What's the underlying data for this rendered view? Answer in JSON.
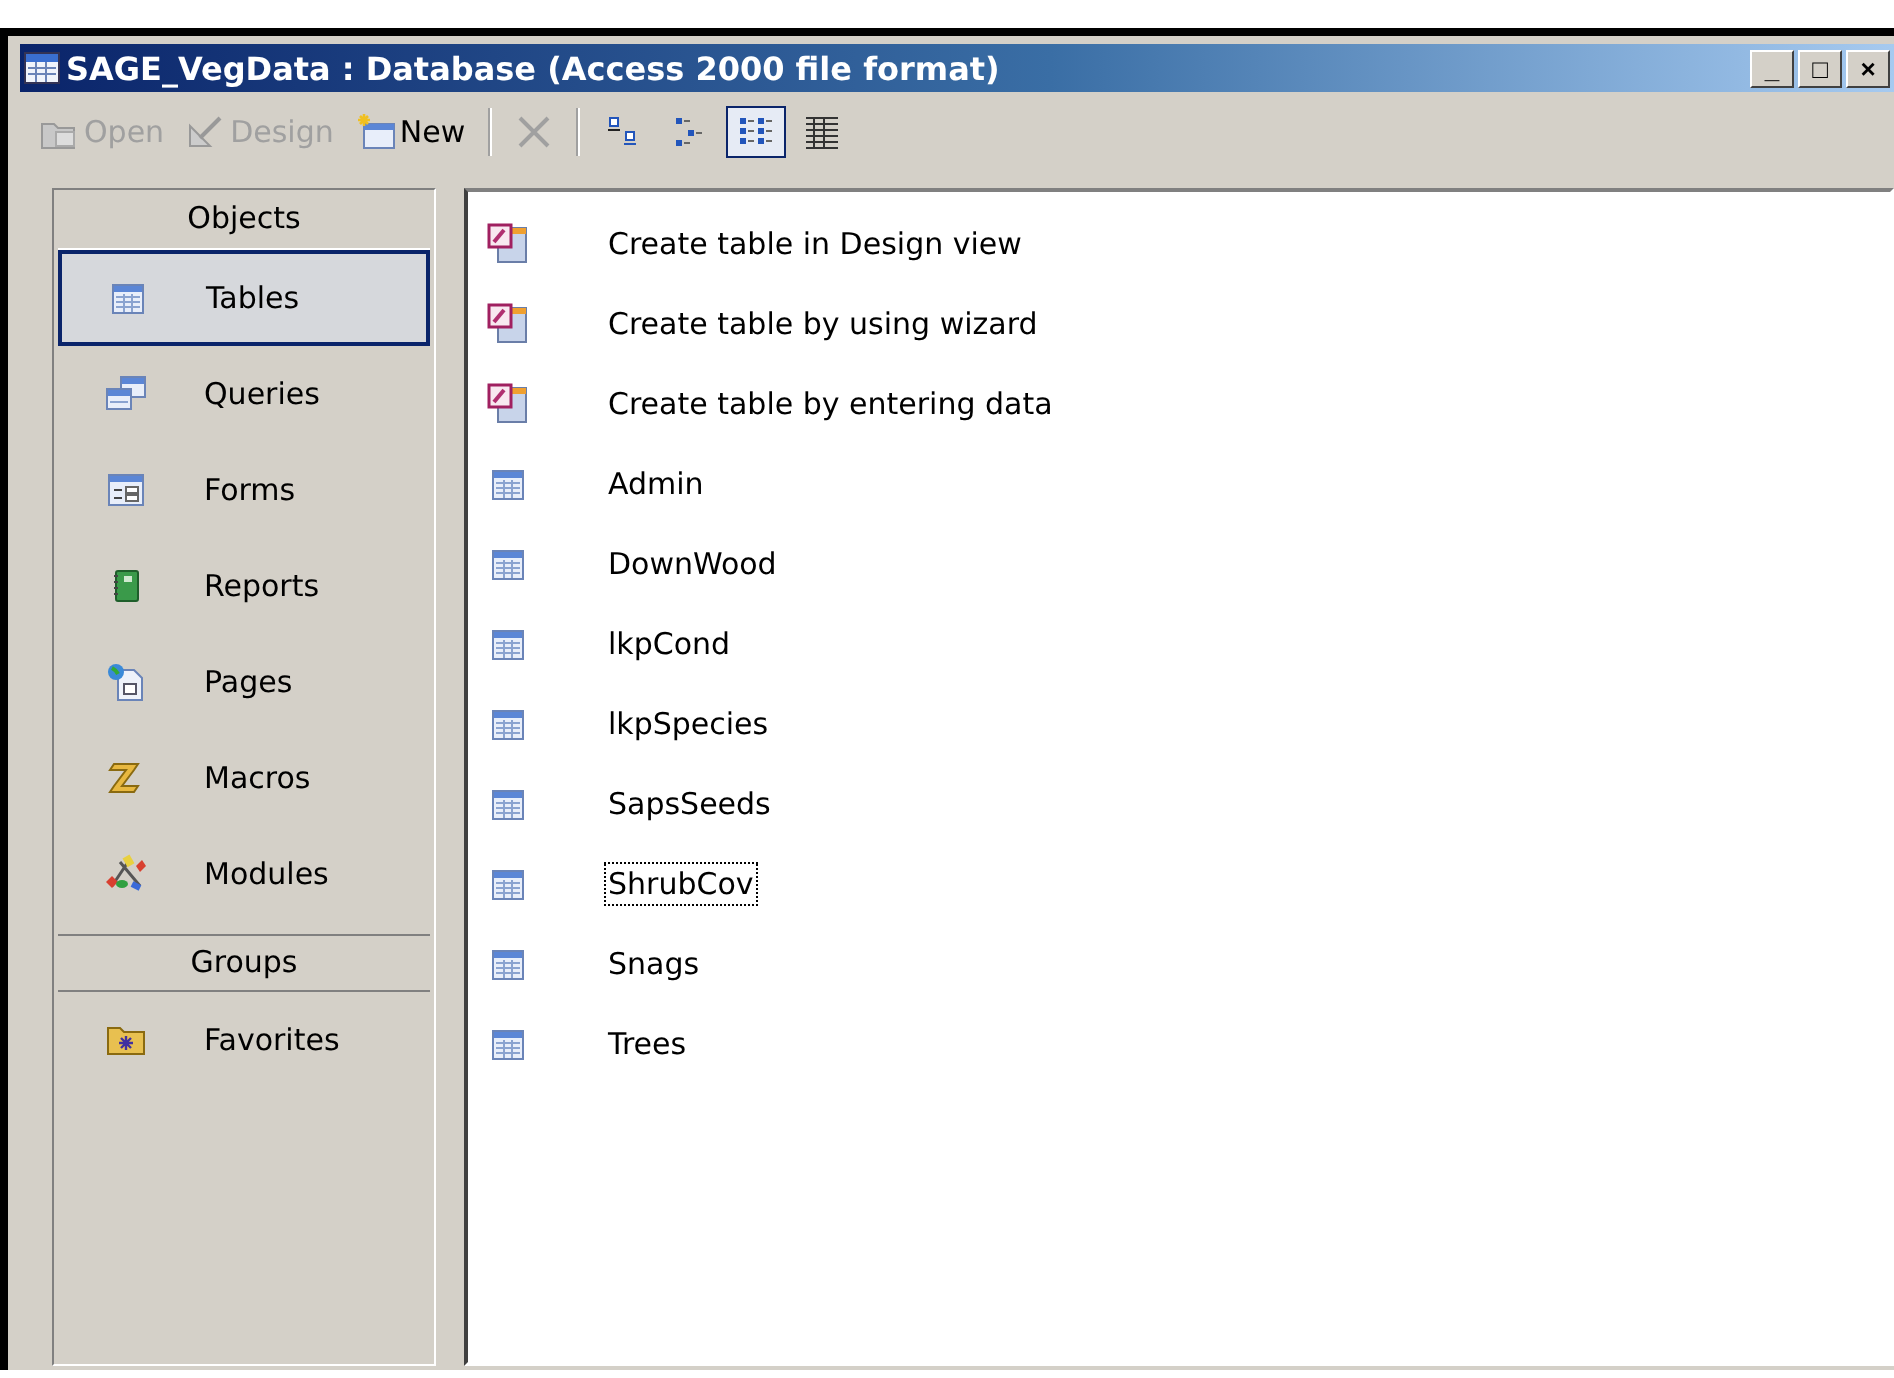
{
  "window": {
    "title": "SAGE_VegData : Database (Access 2000 file format)",
    "controls": [
      "_",
      "□",
      "×"
    ]
  },
  "toolbar": [
    {
      "kind": "open",
      "label": "Open",
      "disabled": true
    },
    {
      "kind": "design",
      "label": "Design",
      "disabled": true
    },
    {
      "kind": "new",
      "label": "New",
      "disabled": false
    },
    {
      "kind": "delete",
      "disabled": true
    },
    {
      "kind": "large-icons",
      "selected": false
    },
    {
      "kind": "small-icons",
      "selected": false
    },
    {
      "kind": "list",
      "selected": true
    },
    {
      "kind": "details",
      "selected": false
    }
  ],
  "sidebar": {
    "objects_heading": "Objects",
    "items": [
      {
        "kind": "tables",
        "label": "Tables",
        "selected": true
      },
      {
        "kind": "queries",
        "label": "Queries",
        "selected": false
      },
      {
        "kind": "forms",
        "label": "Forms",
        "selected": false
      },
      {
        "kind": "reports",
        "label": "Reports",
        "selected": false
      },
      {
        "kind": "pages",
        "label": "Pages",
        "selected": false
      },
      {
        "kind": "macros",
        "label": "Macros",
        "selected": false
      },
      {
        "kind": "modules",
        "label": "Modules",
        "selected": false
      }
    ],
    "groups_heading": "Groups",
    "groups": [
      {
        "kind": "favorites",
        "label": "Favorites",
        "selected": false
      }
    ]
  },
  "list": {
    "items": [
      {
        "kind": "wizard",
        "label": "Create table in Design view",
        "focused": false
      },
      {
        "kind": "wizard",
        "label": "Create table by using wizard",
        "focused": false
      },
      {
        "kind": "wizard",
        "label": "Create table by entering data",
        "focused": false
      },
      {
        "kind": "table",
        "label": "Admin",
        "focused": false
      },
      {
        "kind": "table",
        "label": "DownWood",
        "focused": false
      },
      {
        "kind": "table",
        "label": "lkpCond",
        "focused": false
      },
      {
        "kind": "table",
        "label": "lkpSpecies",
        "focused": false
      },
      {
        "kind": "table",
        "label": "SapsSeeds",
        "focused": false
      },
      {
        "kind": "table",
        "label": "ShrubCov",
        "focused": true
      },
      {
        "kind": "table",
        "label": "Snags",
        "focused": false
      },
      {
        "kind": "table",
        "label": "Trees",
        "focused": false
      }
    ]
  }
}
